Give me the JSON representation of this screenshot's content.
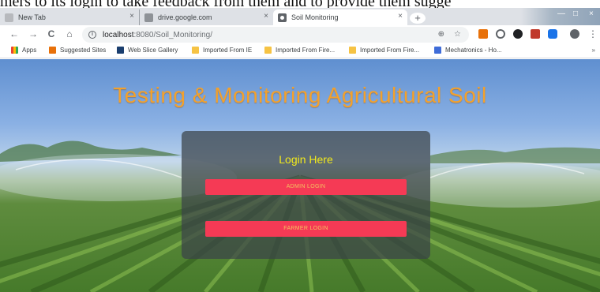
{
  "caption": "mers to its login to take feedback from them and to provide them sugge",
  "browser": {
    "tabs": [
      {
        "label": "New Tab"
      },
      {
        "label": "drive.google.com"
      },
      {
        "label": "Soil Monitoring"
      }
    ],
    "tab_close_glyph": "×",
    "new_tab_glyph": "+",
    "window_controls": {
      "minimize": "—",
      "maximize": "□",
      "close": "×"
    },
    "url_host": "localhost",
    "url_rest": ":8080/Soil_Monitoring/",
    "nav": {
      "back": "←",
      "forward": "→",
      "reload": "C",
      "home": "⌂"
    },
    "omnibox_icons": {
      "zoom": "⊕",
      "star": "☆"
    },
    "bookmarks": [
      {
        "label": "Apps"
      },
      {
        "label": "Suggested Sites"
      },
      {
        "label": "Web Slice Gallery"
      },
      {
        "label": "Imported From IE"
      },
      {
        "label": "Imported From Fire..."
      },
      {
        "label": "Imported From Fire..."
      },
      {
        "label": "Mechatronics - Ho..."
      }
    ],
    "bookmarks_more": "»",
    "menu_glyph": "⋮"
  },
  "page": {
    "title": "Testing & Monitoring Agricultural Soil",
    "login": {
      "heading": "Login Here",
      "admin_button": "ADMIN LOGIN",
      "farmer_button": "FARMER LOGIN"
    }
  },
  "colors": {
    "title": "#f3a12c",
    "login_heading": "#f2ea1b",
    "button_bg": "#f53a55",
    "button_text": "#f4c25e"
  }
}
